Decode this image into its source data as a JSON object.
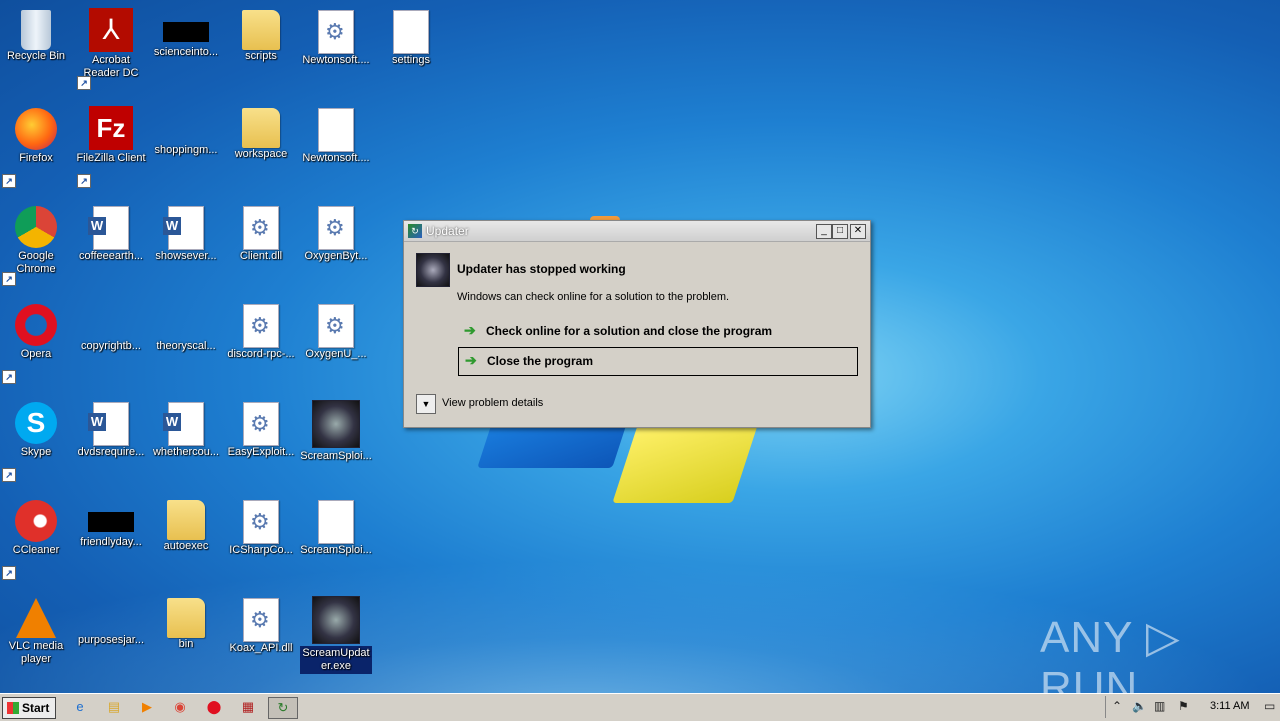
{
  "desktop": {
    "icons": [
      {
        "label": "Recycle Bin"
      },
      {
        "label": "Acrobat Reader DC"
      },
      {
        "label": "scienceinto..."
      },
      {
        "label": "scripts"
      },
      {
        "label": "Newtonsoft...."
      },
      {
        "label": "settings"
      },
      {
        "label": "Firefox"
      },
      {
        "label": "FileZilla Client"
      },
      {
        "label": "shoppingm..."
      },
      {
        "label": "workspace"
      },
      {
        "label": "Newtonsoft...."
      },
      {
        "label": "Google Chrome"
      },
      {
        "label": "coffeeearth..."
      },
      {
        "label": "showsever..."
      },
      {
        "label": "Client.dll"
      },
      {
        "label": "OxygenByt..."
      },
      {
        "label": "Opera"
      },
      {
        "label": "copyrightb..."
      },
      {
        "label": "theoryscal..."
      },
      {
        "label": "discord-rpc-..."
      },
      {
        "label": "OxygenU_..."
      },
      {
        "label": "Skype"
      },
      {
        "label": "dvdsrequire..."
      },
      {
        "label": "whethercou..."
      },
      {
        "label": "EasyExploit..."
      },
      {
        "label": "ScreamSploi..."
      },
      {
        "label": "CCleaner"
      },
      {
        "label": "friendlyday..."
      },
      {
        "label": "autoexec"
      },
      {
        "label": "ICSharpCo..."
      },
      {
        "label": "ScreamSploi..."
      },
      {
        "label": "VLC media player"
      },
      {
        "label": "purposesjar..."
      },
      {
        "label": "bin"
      },
      {
        "label": "Koax_API.dll"
      },
      {
        "label": "ScreamUpdater.exe"
      }
    ]
  },
  "dialog": {
    "title": "Updater",
    "heading": "Updater has stopped working",
    "subtext": "Windows can check online for a solution to the problem.",
    "option_check": "Check online for a solution and close the program",
    "option_close": "Close the program",
    "details": "View problem details",
    "minimize": "_",
    "maximize": "□",
    "close": "✕"
  },
  "taskbar": {
    "start_label": "Start",
    "clock": "3:11 AM"
  },
  "watermark": "ANY ▷ RUN"
}
